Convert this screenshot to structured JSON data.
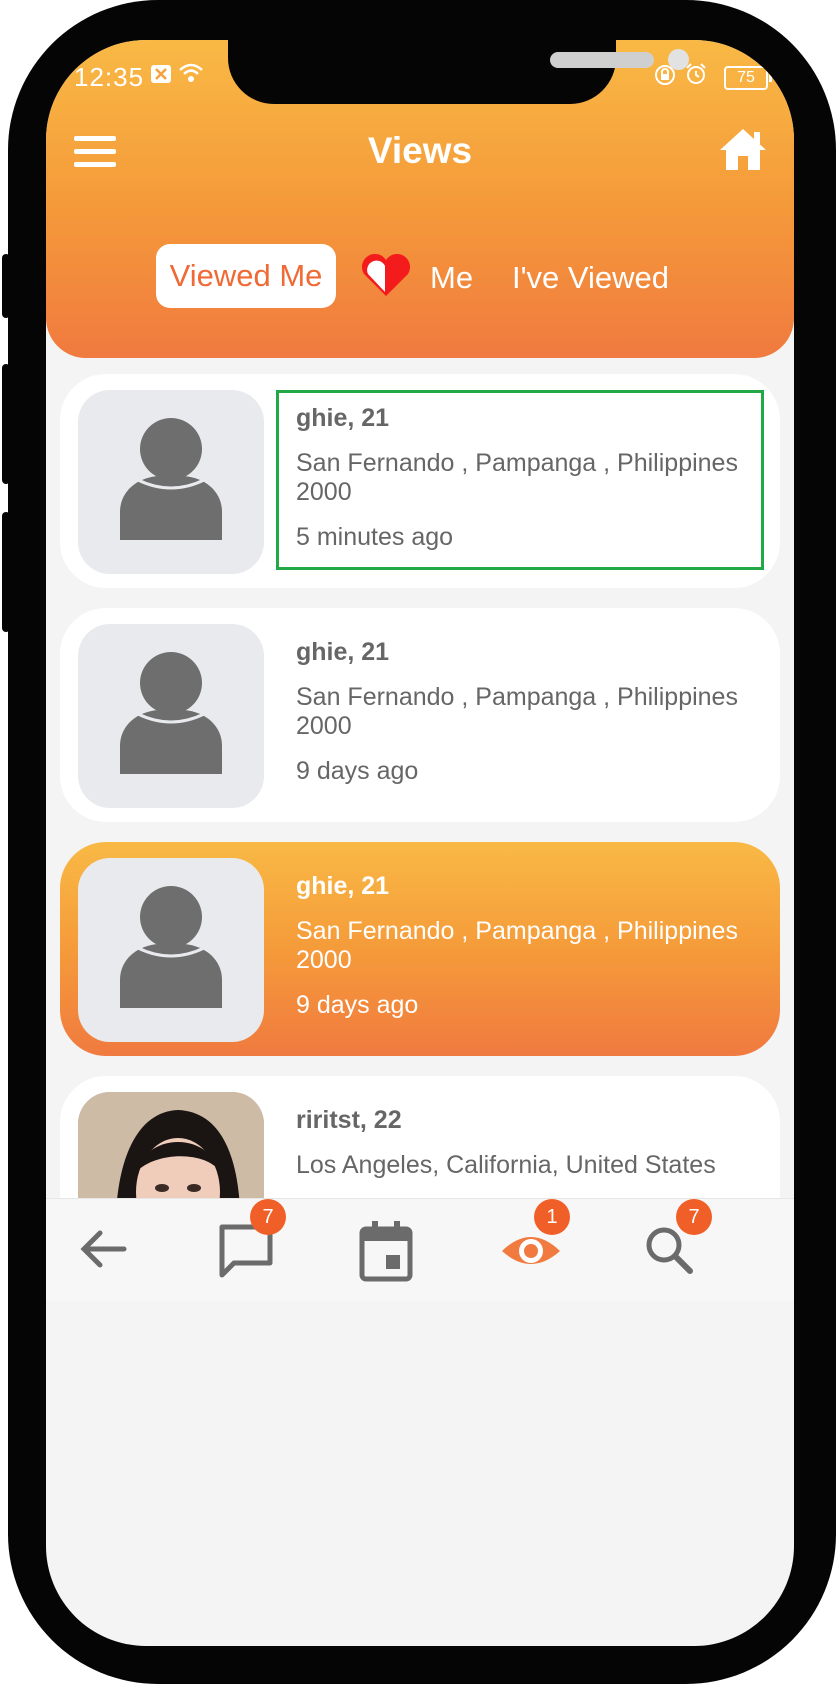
{
  "status_bar": {
    "time": "12:35",
    "battery": "75"
  },
  "header": {
    "title": "Views"
  },
  "tabs": {
    "viewed_me": "Viewed Me",
    "me": "Me",
    "ive_viewed": "I've Viewed"
  },
  "views": [
    {
      "name": "ghie, 21",
      "location": "San Fernando , Pampanga , Philippines 2000",
      "time": "5 minutes ago"
    },
    {
      "name": "ghie, 21",
      "location": "San Fernando , Pampanga , Philippines 2000",
      "time": "9 days ago"
    },
    {
      "name": "ghie, 21",
      "location": "San Fernando , Pampanga , Philippines 2000",
      "time": "9 days ago"
    },
    {
      "name": "riritst, 22",
      "location": "Los Angeles, California, United States",
      "time": ""
    }
  ],
  "bottom_nav": {
    "messages_badge": "7",
    "views_badge": "1",
    "search_badge": "7"
  },
  "colors": {
    "accent": "#f07a3f",
    "gradient_top": "#f9b945",
    "badge": "#f05f27",
    "focus_outline": "#22a847"
  }
}
